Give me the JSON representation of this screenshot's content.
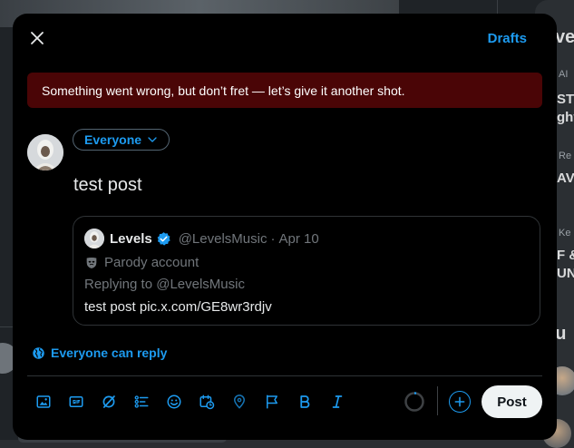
{
  "background": {
    "right_fragments": [
      "ve",
      "AI",
      "ST",
      "ght",
      "Re",
      "AV S",
      "Ke",
      "F &",
      "UNDE",
      "ou"
    ]
  },
  "modal": {
    "drafts_label": "Drafts",
    "error_message": "Something went wrong, but don’t fret — let’s give it another shot.",
    "audience_label": "Everyone",
    "post_text": "test post",
    "quote": {
      "name": "Levels",
      "handle": "@LevelsMusic",
      "separator": "·",
      "date": "Apr 10",
      "parody_label": "Parody account",
      "replying_to": "Replying to @LevelsMusic",
      "body": "test post pic.x.com/GE8wr3rdjv"
    },
    "reply_setting_label": "Everyone can reply",
    "post_button_label": "Post"
  },
  "toolbar_icons": [
    "media-icon",
    "gif-icon",
    "grok-icon",
    "poll-icon",
    "emoji-icon",
    "schedule-icon",
    "location-icon",
    "flag-icon",
    "bold-icon",
    "italic-icon"
  ],
  "colors": {
    "accent": "#1d9bf0",
    "error_bg": "#4a0506",
    "modal_bg": "#000000",
    "post_button_bg": "#eff3f4"
  }
}
